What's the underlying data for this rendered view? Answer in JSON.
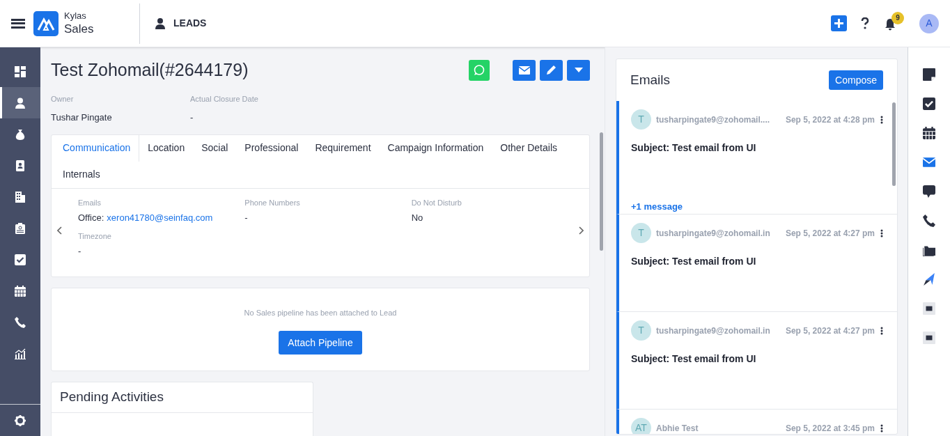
{
  "header": {
    "app_name": "Kylas",
    "product": "Sales",
    "module": "LEADS",
    "notification_count": "9",
    "avatar": "A"
  },
  "sidebar": {
    "items": [
      {
        "selected": false
      },
      {
        "selected": true
      },
      {
        "selected": false
      },
      {
        "selected": false
      },
      {
        "selected": false
      },
      {
        "selected": false
      },
      {
        "selected": false
      },
      {
        "selected": false
      },
      {
        "selected": false
      },
      {
        "selected": false
      }
    ]
  },
  "lead": {
    "title": "Test Zohomail(#2644179)",
    "fields": [
      {
        "label": "Owner",
        "value": "Tushar Pingate"
      },
      {
        "label": "Actual Closure Date",
        "value": "-"
      }
    ]
  },
  "tabs": [
    {
      "label": "Communication",
      "selected": true
    },
    {
      "label": "Location",
      "selected": false
    },
    {
      "label": "Social",
      "selected": false
    },
    {
      "label": "Professional",
      "selected": false
    },
    {
      "label": "Requirement",
      "selected": false
    },
    {
      "label": "Campaign Information",
      "selected": false
    },
    {
      "label": "Other Details",
      "selected": false
    },
    {
      "label": "Internals",
      "selected": false
    }
  ],
  "details": [
    {
      "label": "Emails",
      "prefix": "Office:",
      "link": "xeron41780@seinfaq.com"
    },
    {
      "label": "Phone Numbers",
      "value": "-"
    },
    {
      "label": "Do Not Disturb",
      "value": "No"
    },
    {
      "label": "Timezone",
      "value": "-"
    }
  ],
  "pipeline": {
    "message": "No Sales pipeline has been attached to Lead",
    "button": "Attach Pipeline"
  },
  "pending": {
    "title": "Pending Activities"
  },
  "emails": {
    "title": "Emails",
    "compose": "Compose",
    "items": [
      {
        "avatar": "T",
        "sender": "tusharpingate9@zohomail....",
        "date": "Sep 5, 2022 at 4:28 pm",
        "subject": "Subject: Test email from UI",
        "more": "+1 message"
      },
      {
        "avatar": "T",
        "sender": "tusharpingate9@zohomail.in",
        "date": "Sep 5, 2022 at 4:27 pm",
        "subject": "Subject: Test email from UI"
      },
      {
        "avatar": "T",
        "sender": "tusharpingate9@zohomail.in",
        "date": "Sep 5, 2022 at 4:27 pm",
        "subject": "Subject: Test email from UI"
      },
      {
        "avatar": "AT",
        "sender": "Abhie Test",
        "date": "Sep 5, 2022 at 3:45 pm"
      }
    ]
  },
  "rail": {
    "items": [
      {
        "selected": false
      },
      {
        "selected": false
      },
      {
        "selected": false
      },
      {
        "selected": true
      },
      {
        "selected": false
      },
      {
        "selected": false
      },
      {
        "selected": false
      },
      {
        "selected": false
      },
      {
        "selected": false
      },
      {
        "selected": false
      }
    ]
  }
}
